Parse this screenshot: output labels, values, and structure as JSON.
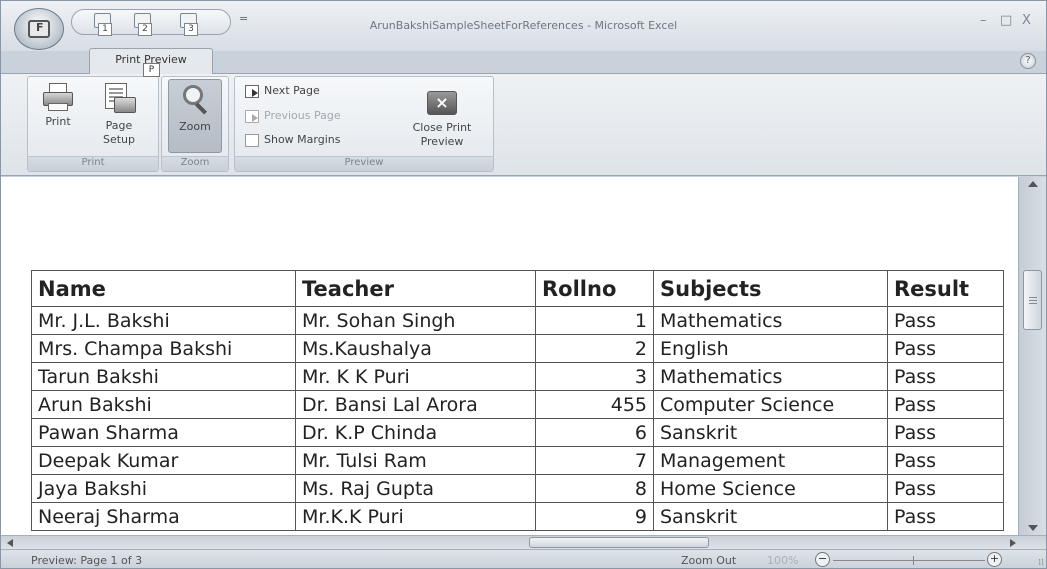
{
  "window": {
    "title": "ArunBakshiSampleSheetForReferences - Microsoft Excel",
    "controls": {
      "minimize": "–",
      "maximize": "□",
      "close": "X"
    }
  },
  "office_button": {
    "keytip": "F"
  },
  "quick_access": {
    "items": [
      {
        "icon": "save-icon",
        "keytip": "1"
      },
      {
        "icon": "undo-icon",
        "keytip": "2"
      },
      {
        "icon": "redo-icon",
        "keytip": "3"
      }
    ],
    "dropdown": "="
  },
  "ribbon": {
    "tab": "Print Preview",
    "tab_keytip": "P",
    "help": "?",
    "groups": {
      "print": {
        "label": "Print",
        "print_button": "Print",
        "page_setup_button": "Page Setup"
      },
      "zoom": {
        "label": "Zoom",
        "zoom_button": "Zoom"
      },
      "preview": {
        "label": "Preview",
        "next_page": "Next Page",
        "previous_page": "Previous Page",
        "show_margins": "Show Margins",
        "close_preview": "Close Print Preview"
      }
    }
  },
  "sheet": {
    "columns": [
      "Name",
      "Teacher",
      "Rollno",
      "Subjects",
      "Result"
    ],
    "rows": [
      [
        "Mr. J.L. Bakshi",
        "Mr. Sohan Singh",
        "1",
        "Mathematics",
        "Pass"
      ],
      [
        "Mrs. Champa Bakshi",
        "Ms.Kaushalya",
        "2",
        "English",
        "Pass"
      ],
      [
        "Tarun Bakshi",
        "Mr. K K Puri",
        "3",
        "Mathematics",
        "Pass"
      ],
      [
        "Arun Bakshi",
        "Dr. Bansi Lal Arora",
        "455",
        "Computer Science",
        "Pass"
      ],
      [
        "Pawan Sharma",
        "Dr. K.P Chinda",
        "6",
        "Sanskrit",
        "Pass"
      ],
      [
        "Deepak Kumar",
        "Mr. Tulsi Ram",
        "7",
        "Management",
        "Pass"
      ],
      [
        "Jaya Bakshi",
        "Ms. Raj Gupta",
        "8",
        "Home Science",
        "Pass"
      ],
      [
        "Neeraj Sharma",
        "Mr.K.K Puri",
        "9",
        "Sanskrit",
        "Pass"
      ]
    ]
  },
  "statusbar": {
    "text": "Preview: Page 1 of 3",
    "zoom_out": "Zoom Out",
    "zoom_level": "100%",
    "zoom_minus": "−",
    "zoom_plus": "+"
  }
}
